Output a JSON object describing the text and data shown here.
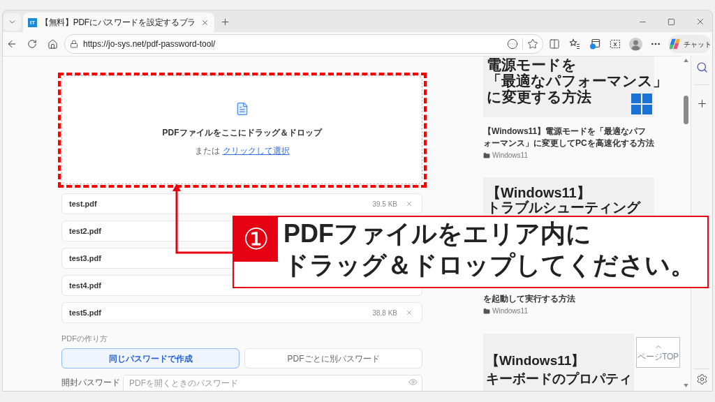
{
  "browser": {
    "tabs": [
      {
        "favicon": "IT",
        "title": "【無料】PDFにパスワードを設定するブラ",
        "selected": true
      }
    ],
    "url": "https://jo-sys.net/pdf-password-tool/",
    "chat_button": "チャット"
  },
  "uploader": {
    "title": "PDFファイルをここにドラッグ＆ドロップ",
    "or_text": "または",
    "link": "クリックして選択"
  },
  "files": [
    {
      "name": "test.pdf",
      "size": "39.5 KB"
    },
    {
      "name": "test2.pdf"
    },
    {
      "name": "test3.pdf"
    },
    {
      "name": "test4.pdf"
    },
    {
      "name": "test5.pdf",
      "size": "38.8 KB"
    }
  ],
  "creation_mode": {
    "label": "PDFの作り方",
    "options": [
      {
        "label": "同じパスワードで作成",
        "selected": true
      },
      {
        "label": "PDFごとに別パスワード",
        "selected": false
      }
    ]
  },
  "open_password": {
    "label": "開封パスワード",
    "placeholder": "PDFを開くときのパスワード"
  },
  "articles": [
    {
      "thumbnail_lines": [
        "電源モードを",
        "「最適なパフォーマンス」",
        "に変更する方法"
      ],
      "logo": true,
      "caption": "【Windows11】電源モードを「最適なパフォーマンス」に変更してPCを高速化する方法",
      "category": "Windows11"
    },
    {
      "thumbnail_lines": [
        "【Windows11】",
        "トラブルシューティング"
      ],
      "caption": "を起動して実行する方法",
      "category": "Windows11"
    },
    {
      "thumbnail_lines": [
        "【Windows11】",
        "キーボードのプロパティ"
      ]
    }
  ],
  "page_top_button": "ページTOP",
  "callout": {
    "number": "①",
    "lines": [
      "PDFファイルをエリア内に",
      "ドラッグ＆ドロップしてください。"
    ]
  }
}
